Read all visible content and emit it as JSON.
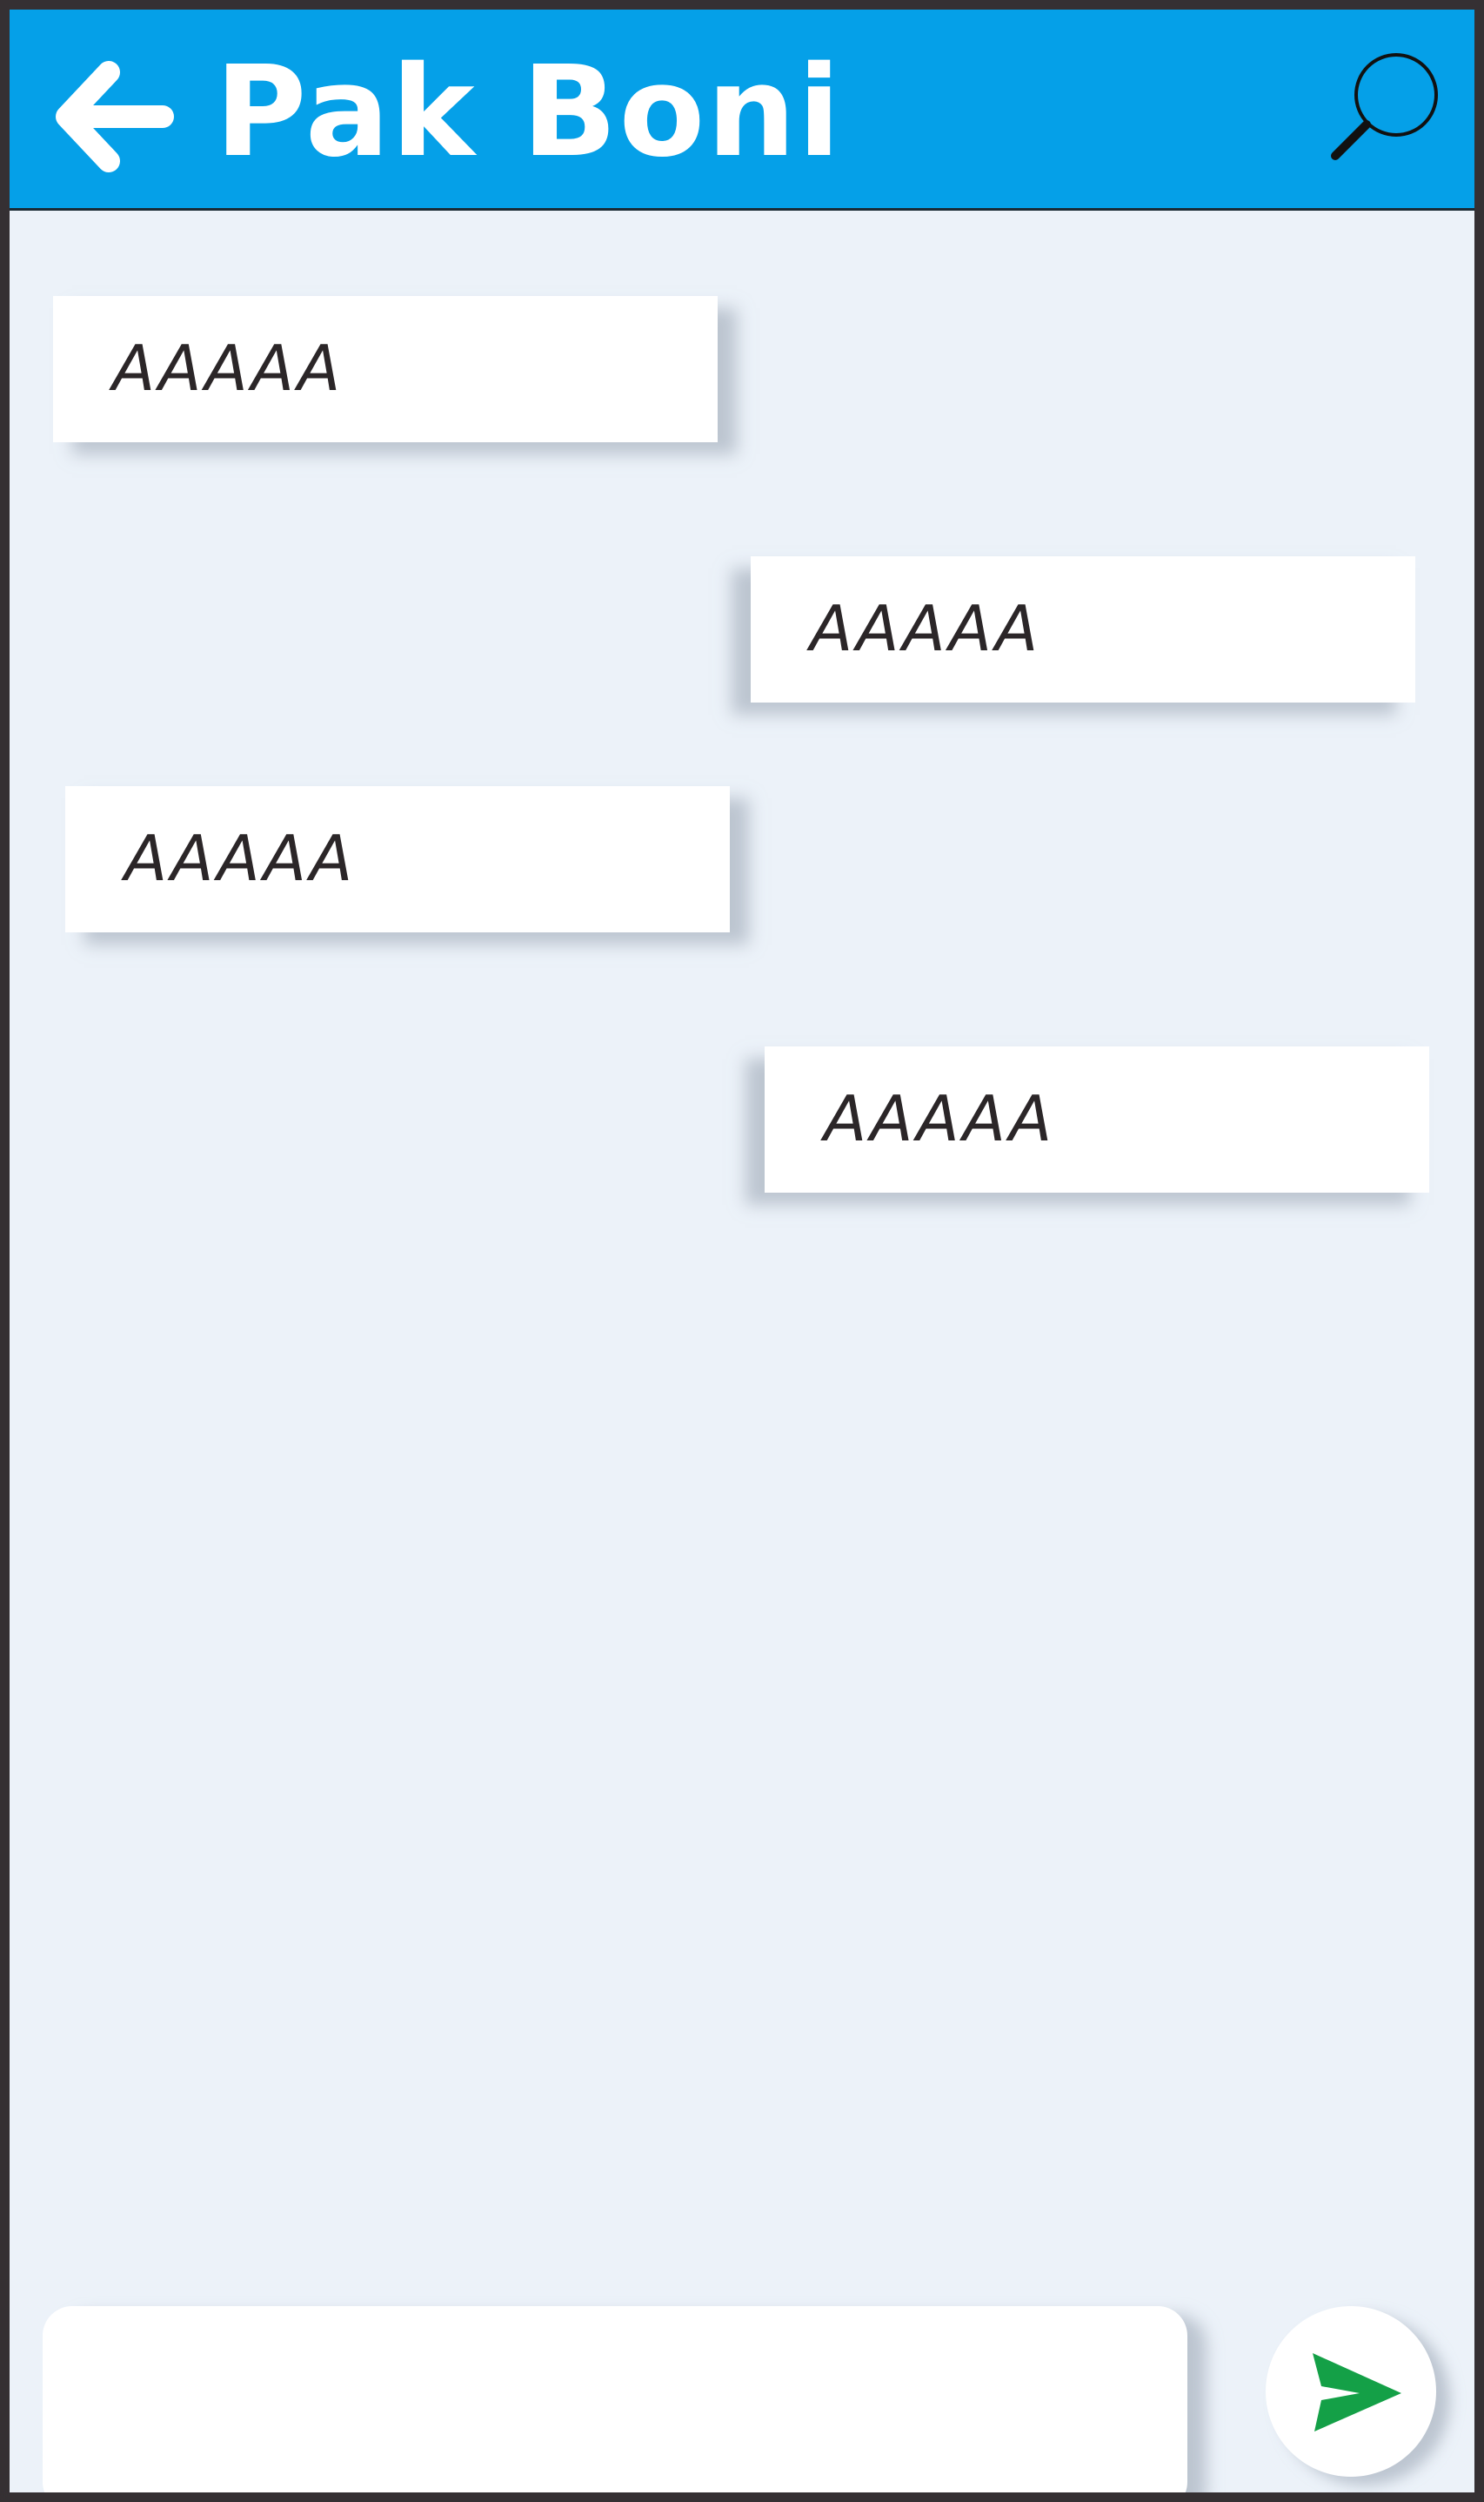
{
  "header": {
    "title": "Pak Boni",
    "back_icon": "arrow-left-icon",
    "search_icon": "search-icon",
    "bg_color": "#05a0e8"
  },
  "messages": [
    {
      "side": "left",
      "text": "AAAAA"
    },
    {
      "side": "right",
      "text": "AAAAA"
    },
    {
      "side": "left",
      "text": "AAAAA"
    },
    {
      "side": "right",
      "text": "AAAAA"
    }
  ],
  "composer": {
    "value": "",
    "placeholder": "",
    "send_icon": "send-icon",
    "send_color": "#14a047"
  },
  "colors": {
    "background": "#ecf2f9",
    "frame": "#353033",
    "bubble": "#ffffff"
  }
}
